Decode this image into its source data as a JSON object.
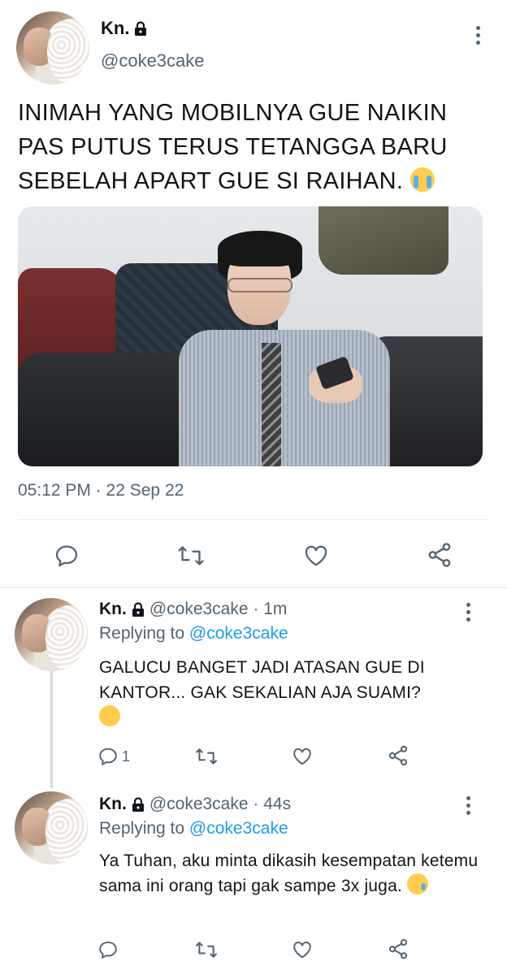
{
  "main_tweet": {
    "display_name": "Kn.",
    "handle": "@coke3cake",
    "text": "INIMAH YANG MOBILNYA GUE NAIKIN PAS PUTUS TERUS TETANGGA BARU SEBELAH APART GUE SI RAIHAN.",
    "text_emoji": "loudly-crying-face",
    "timestamp": "05:12 PM · 22 Sep 22",
    "actions": {
      "reply_icon": "reply-icon",
      "retweet_icon": "retweet-icon",
      "like_icon": "like-icon",
      "share_icon": "share-icon"
    }
  },
  "replies": [
    {
      "display_name": "Kn.",
      "handle_time": "@coke3cake · 1m",
      "replying_prefix": "Replying to",
      "replying_to": "@coke3cake",
      "text": "GALUCU BANGET JADI ATASAN GUE DI KANTOR... GAK SEKALIAN AJA SUAMI?",
      "text_emoji": "face-holding-back-tears",
      "reply_count": "1"
    },
    {
      "display_name": "Kn.",
      "handle_time": "@coke3cake · 44s",
      "replying_prefix": "Replying to",
      "replying_to": "@coke3cake",
      "text": "Ya Tuhan, aku minta dikasih kesempatan ketemu sama ini orang tapi gak sampe 3x juga.",
      "text_emoji": "smiling-face-with-tear",
      "reply_count": ""
    }
  ],
  "colors": {
    "text": "#0f1419",
    "secondary": "#536471",
    "link": "#1d9bf0",
    "divider": "#e6ecf0"
  }
}
